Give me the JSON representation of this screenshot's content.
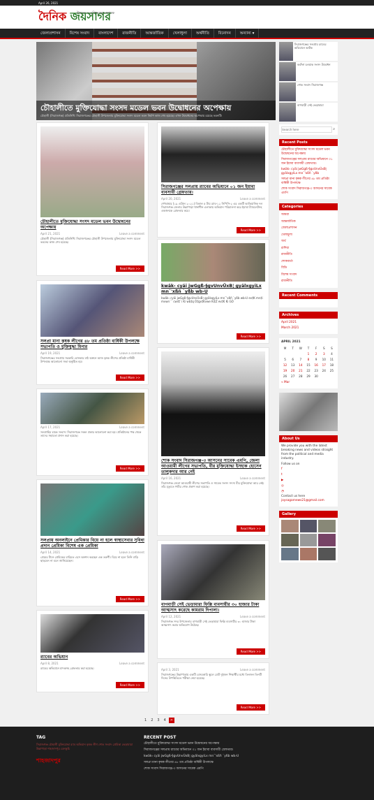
{
  "date": "April 26, 2021",
  "logo": {
    "a": "দৈনিক",
    "b": "জয়সাগর"
  },
  "tagline": "উন্নয়ন ও মুক্তিযুদ্ধের স্বপক্ষে",
  "nav": [
    "জেলাপ্রশাসন",
    "বিশেষ সংবাদ",
    "বাংলাদেশ",
    "রাজনীতি",
    "আন্তর্জাতিক",
    "খেলাধুলা",
    "অর্থনীতি",
    "বিনোদন",
    "অন্যান্য ▾"
  ],
  "hero": {
    "title": "চৌহালীতে মুক্তিযোদ্ধা সংসদ মডেল ভবন উদ্বোধনের অপেক্ষায়",
    "excerpt": "চৌহালী (সিরাজগঞ্জ) প্রতিনিধি: সিরাজগঞ্জের চৌহালী উপজেলায় মুক্তিযোদ্ধা সংসদ মডেল ভবন নির্মাণ কাজ শেষ হয়েছে। এখন উদ্বোধনের অপেক্ষায় রয়েছে ভবনটি।"
  },
  "thumbs": [
    "সিরাজগঞ্জের সলপ্রায় র‍্যাবের অভিযানে আটক",
    "কবাঁদ্গ চলমাক সংসদ উদ্বোধন",
    "শোক সংবাদ সিরাজগঞ্জ",
    "বাগবাড়ী সেই ভেড়ামারা"
  ],
  "read_more": "Read More >>",
  "cards": [
    {
      "title": "চৌহালীতে মুক্তিযোদ্ধা সংসদ মডেল ভবন উদ্বোধনের অপেক্ষায়",
      "date": "April 21, 2021",
      "comment": "Leave a comment",
      "excerpt": "চৌহালী (সিরাজগঞ্জ) প্রতিনিধি: সিরাজগঞ্জের চৌহালী উপজেলায় মুক্তিযোদ্ধা সংসদ মডেল ভবনের কাজ শেষ হয়েছে।"
    },
    {
      "title": "সিরাজগঞ্জের সলপ্রায় র‍্যাবের অভিযানে ০১ জন ইয়াবা ব্যবসায়ী গ্রেফতার।",
      "date": "April 20, 2021",
      "comment": "Leave a comment",
      "excerpt": "শেখবাহার (১৯ এপ্রিল ২০২১) বিকাল ৫ টায় র‍্যাব-১২ সিপিসি-২ এর একটি আভিযানিক দল সিরাজগঞ্জ জেলার উল্লাপাড়া থানাধীন এলাকায় অভিযান পরিচালনা করে ইয়াবা ট্যাবলেটসহ একজনকে গ্রেফতার করে।"
    },
    {
      "title": "সলপ্রা মানা কৃষক লীগের ৪৮ তম প্রতিষ্ঠা বার্ষিকী উপলক্ষে সভাপতি ও মুক্তিযুদ্ধা মিনার",
      "date": "April 19, 2021",
      "comment": "Leave a comment",
      "excerpt": "সিরাজগঞ্জের সলপ্রায় সরকারি বোনকার মাঠ অঙ্গনে আজ কৃষক লীগের প্রতিষ্ঠা বার্ষিকী উপলক্ষে আলোচনা সভা অনুষ্ঠিত হয়।"
    },
    {
      "title": "kwäk‹ cyäi jwGgß-§gvUnvÛxB¦ gyälxgyiLx mn¯'xßñ `yßb wb›U",
      "date": "",
      "comment": "",
      "excerpt": "kwäk‹ cyäi jwGgß-§gvUnvÛxB¦ gyälxgyiLx mn¯'xßñ `yßb wb›U ev‡K mn‡i mvwn`¨ cwil‡`i Ki wb‡q Ò‡gv‡Kvwe Ki‡Z ev‡K Ki GÓ"
    },
    {
      "title": "",
      "date": "April 17, 2021",
      "comment": "Leave a comment",
      "excerpt": "সলপ্রাহিম চান্দ্রে সংবাদ: সিরাজগঞ্জে সকল প্রকার আলোচনা করা হয়। প্রতিষ্ঠানের পক্ষ থেকে তাদের সহায়তা প্রদান করা হয়েছে।"
    },
    {
      "title": "শোক সংবাদ সিরাজগঞ্জ-৩ আসনের সাবেক এমপি, জেলা আওয়ামী লীগের সভাপতি, বীর মুক্তিযোদ্ধা ইসহাক হোসেন তালুকদার আর নেই",
      "date": "April 16, 2021",
      "comment": "Leave a comment",
      "excerpt": "সিরাজগঞ্জ জেলা আওয়ামী লীগের সভাপতি ও সাবেক সংসদ সদস্য বীর মুক্তিযোদ্ধা আর নেই। তাঁর মৃত্যুতে গভীর শোক প্রকাশ করা হয়েছে।"
    },
    {
      "title": "সলপ্রায় অনলাইনে প্রেমিকার বিয়ে না হলে স্বাস্থ্যসেবার সুবিধা প্রদান প্রেমিকা বিশেষ এক প্রেমিকা",
      "date": "April 14, 2021",
      "comment": "Leave a comment",
      "excerpt": "প্রেমের টানে প্রেমিকের বাড়িতে এসে অনশন করছেন এক তরুণী। বিয়ে না হলে তিনি বাড়ি ছাড়বেন না বলে জানিয়েছেন।"
    },
    {
      "title": "বাগবাড়ী সেই ভেড়ামারা ফিল্লি ব্যবসায়ীর ৩০ হাজার টাকা আত্মসাৎ করেছে কামরাম দিপালা।",
      "date": "April 12, 2021",
      "comment": "Leave a comment",
      "excerpt": "সিরাজগঞ্জ সদর উপজেলার বাগবাড়ী সেই ভেড়ামারা ফিল্লি ব্যবসায়ীর ৩০ হাজার টাকা আত্মসাৎ করার অভিযোগ উঠেছে।"
    },
    {
      "title": "র‍্যাবের অভিযান",
      "date": "April 8, 2021",
      "comment": "Leave a comment",
      "excerpt": "র‍্যাবের অভিযানে মাদকসহ গ্রেফতার করা হয়েছে।"
    },
    {
      "title": "",
      "date": "April 3, 2021",
      "comment": "Leave a comment",
      "excerpt": "সিরাজগঞ্জের উল্লাপাড়ায় একটি বেসরকারি স্কুলে মোট দুইজন শিক্ষার্থীর মধ্যে তিনজন তিনটি দিনের উপস্থিতিতে পরীক্ষা নেয়া হয়েছে।"
    }
  ],
  "sidebar": {
    "search_placeholder": "Search here",
    "recent_posts_head": "Recent Posts",
    "recent_posts": [
      "চৌহালীতে মুক্তিযোদ্ধা সংসদ মডেল ভবন উদ্বোধনের অপেক্ষায়",
      "সিরাজগঞ্জের সলপ্রায় র‍্যাবের অভিযানে ০১ জন ইয়াবা ব্যবসায়ী গ্রেফতার।",
      "kwäk‹ cyäi jwGgß-§gvUnvÛxB¦ gyälxgyiLx mn¯'xßñ `yßb",
      "সলপ্রা মানা কৃষক লীগের ৪৮ তম প্রতিষ্ঠা বার্ষিকী উপলক্ষে",
      "শোক সংবাদ সিরাজগঞ্জ-৩ আসনের সাবেক এমপি"
    ],
    "categories_head": "Categories",
    "categories": [
      "আমরা",
      "আন্তর্জাতিক",
      "জেলাপ্রশাসন",
      "খেলাধুলা",
      "অর্থ",
      "রাশিয়া",
      "রাজনীতি",
      "শোকবার্তা",
      "বিডি",
      "বিশেষ সংবাদ",
      "রাজনীতি"
    ],
    "comments_head": "Recent Comments",
    "archives_head": "Archives",
    "archives": [
      "April 2021",
      "March 2021"
    ],
    "calendar_month": "APRIL 2021",
    "cal_days": [
      "M",
      "T",
      "W",
      "T",
      "F",
      "S",
      "S"
    ],
    "cal_rows": [
      [
        "",
        "",
        "",
        "1",
        "2",
        "3",
        "4"
      ],
      [
        "5",
        "6",
        "7",
        "8",
        "9",
        "10",
        "11"
      ],
      [
        "12",
        "13",
        "14",
        "15",
        "16",
        "17",
        "18"
      ],
      [
        "19",
        "20",
        "21",
        "22",
        "23",
        "24",
        "25"
      ],
      [
        "26",
        "27",
        "28",
        "29",
        "30",
        "",
        ""
      ]
    ],
    "cal_prev": "« Mar",
    "about_head": "About Us",
    "about_text": "We provide you with the latest breaking news and videos straight from the political and media industry.",
    "follow": "Follow us on",
    "contact": "Contact us here",
    "email": "joysagarnews21@gmail.com",
    "gallery_head": "Gallery"
  },
  "pager": [
    "1",
    "2",
    "3",
    "4"
  ],
  "footer": {
    "tag_head": "TAG",
    "tag_text": "সিরাজগঞ্জ চৌহালী মুক্তিযোদ্ধা র‍্যাব অভিযান কৃষক লীগ শোক সংবাদ প্রেমিকা ভেড়ামারা উল্লাপাড়া শাহজাদপুর বেলকুচি",
    "brand": "শাহজাদপুর",
    "recent_head": "RECENT POST",
    "recent": [
      "চৌহালীতে মুক্তিযোদ্ধা সংসদ মডেল ভবন উদ্বোধনের অপেক্ষায়",
      "সিরাজগঞ্জের সলপ্রায় র‍্যাবের অভিযানে ০১ জন ইয়াবা ব্যবসায়ী গ্রেফতার।",
      "kwäk‹ cyäi jwGgß-§gvUnvÛxB¦ gyälxgyiLx mn¯'xßñ `yßb wb›U",
      "সলপ্রা মানা কৃষক লীগের ৪৮ তম প্রতিষ্ঠা বার্ষিকী উপলক্ষে",
      "শোক সংবাদ সিরাজগঞ্জ-৩ আসনের সাবেক এমপি"
    ]
  }
}
